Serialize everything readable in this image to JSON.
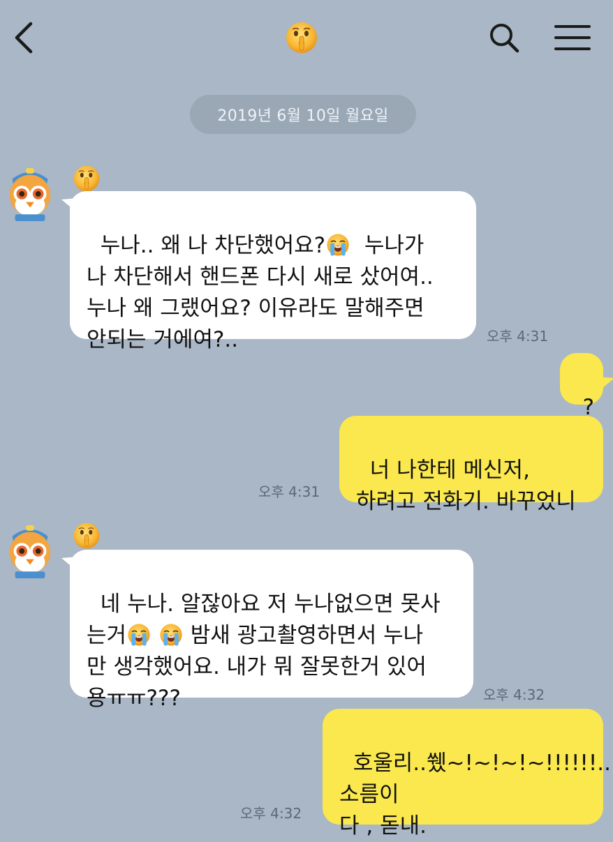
{
  "header": {
    "back_icon": "chevron-left-icon",
    "chat_icon": "shushing-face-emoji",
    "search_icon": "search-icon",
    "menu_icon": "hamburger-menu-icon"
  },
  "date_divider": "2019년 6월 10일 월요일",
  "messages": [
    {
      "direction": "incoming",
      "segments": [
        {
          "t": "누나.. 왜 나 차단했어요?"
        },
        {
          "t": "  누나가\n나 차단해서 핸드폰 다시 새로 샀어여..\n누나 왜 그랬어요? 이유라도 말해주면\n안되는 거에여?.."
        }
      ],
      "time": "오후 4:31"
    },
    {
      "direction": "outgoing",
      "text": "?"
    },
    {
      "direction": "outgoing",
      "text": "너 나한테 메신저,\n하려고 전화기. 바꾸었니",
      "time": "오후 4:31"
    },
    {
      "direction": "incoming",
      "segments": [
        {
          "t": "네 누나. 알잖아요 저 누나없으면 못사\n는거"
        },
        {
          "t": " 밤새 광고촬영하면서 누나\n만 생각했어요. 내가 뭐 잘못한거 있어\n용ㅠㅠ???"
        }
      ],
      "time": "오후 4:32"
    },
    {
      "direction": "outgoing",
      "text": "호울리..쒰~!~!~!~!!!!!!...\n소름이\n다 , 돋내.",
      "time": "오후 4:32"
    }
  ],
  "colors": {
    "background": "#a9b7c6",
    "incoming_bubble": "#ffffff",
    "outgoing_bubble": "#fae84e",
    "date_pill": "#9aa8b6",
    "timestamp": "#5c6976"
  }
}
